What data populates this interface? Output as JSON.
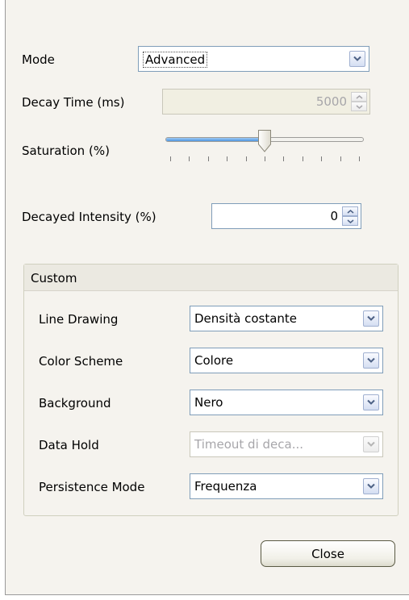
{
  "mode": {
    "label": "Mode",
    "value": "Advanced"
  },
  "decay_time": {
    "label": "Decay Time (ms)",
    "value": "5000"
  },
  "saturation": {
    "label": "Saturation (%)",
    "level_percent": 50,
    "ticks": 11
  },
  "decayed_intensity": {
    "label": "Decayed Intensity (%)",
    "value": "0"
  },
  "custom": {
    "title": "Custom",
    "rows": [
      {
        "label": "Line Drawing",
        "value": "Densità costante",
        "disabled": false
      },
      {
        "label": "Color Scheme",
        "value": "Colore",
        "disabled": false
      },
      {
        "label": "Background",
        "value": "Nero",
        "disabled": false
      },
      {
        "label": "Data Hold",
        "value": "Timeout di deca...",
        "disabled": true
      },
      {
        "label": "Persistence Mode",
        "value": "Frequenza",
        "disabled": false
      }
    ]
  },
  "close_label": "Close",
  "colors": {
    "dialog_bg": "#f5f3ee",
    "field_border": "#7f9db9",
    "slider_fill": "#4e96e0",
    "disabled_text": "#a7a6aa"
  },
  "icons": {
    "dropdown": "chevron-down-icon",
    "spin_up": "arrow-up-icon",
    "spin_down": "arrow-down-icon"
  }
}
